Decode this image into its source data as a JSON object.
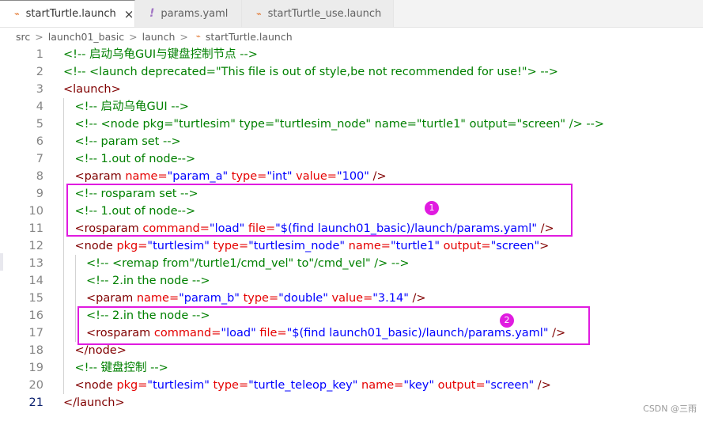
{
  "tabs": [
    {
      "label": "startTurtle.launch",
      "icon": "rss-icon",
      "close": "×",
      "active": true
    },
    {
      "label": "params.yaml",
      "icon": "exclamation-icon",
      "active": false
    },
    {
      "label": "startTurtle_use.launch",
      "icon": "rss-icon",
      "active": false
    }
  ],
  "breadcrumb": [
    "src",
    "launch01_basic",
    "launch",
    "startTurtle.launch"
  ],
  "breadcrumb_sep": ">",
  "line_numbers": [
    "1",
    "2",
    "3",
    "4",
    "5",
    "6",
    "7",
    "8",
    "9",
    "10",
    "11",
    "12",
    "13",
    "14",
    "15",
    "16",
    "17",
    "18",
    "19",
    "20",
    "21"
  ],
  "lines": [
    [
      {
        "t": "<!-- 启动乌龟GUI与键盘控制节点 -->",
        "k": "c"
      }
    ],
    [
      {
        "t": "<!-- <launch deprecated=\"This file is out of style,be not recommended for use!\"> -->",
        "k": "c"
      }
    ],
    [
      {
        "t": "<launch>",
        "k": "t"
      }
    ],
    [
      {
        "t": "<!-- 启动乌龟GUI -->",
        "k": "c"
      }
    ],
    [
      {
        "t": "<!-- <node pkg=\"turtlesim\" type=\"turtlesim_node\" name=\"turtle1\" output=\"screen\" /> -->",
        "k": "c"
      }
    ],
    [
      {
        "t": "<!-- param set -->",
        "k": "c"
      }
    ],
    [
      {
        "t": "<!-- 1.out of node-->",
        "k": "c"
      }
    ],
    [
      {
        "t": "<param",
        "k": "t"
      },
      {
        "t": " name=",
        "k": "a"
      },
      {
        "t": "\"param_a\"",
        "k": "s"
      },
      {
        "t": " type=",
        "k": "a"
      },
      {
        "t": "\"int\"",
        "k": "s"
      },
      {
        "t": " value=",
        "k": "a"
      },
      {
        "t": "\"100\"",
        "k": "s"
      },
      {
        "t": " />",
        "k": "t"
      }
    ],
    [
      {
        "t": "<!-- rosparam set -->",
        "k": "c"
      }
    ],
    [
      {
        "t": "<!-- 1.out of node-->",
        "k": "c"
      }
    ],
    [
      {
        "t": "<rosparam",
        "k": "t"
      },
      {
        "t": " command=",
        "k": "a"
      },
      {
        "t": "\"load\"",
        "k": "s"
      },
      {
        "t": " file=",
        "k": "a"
      },
      {
        "t": "\"$(find launch01_basic)/launch/params.yaml\"",
        "k": "s"
      },
      {
        "t": " />",
        "k": "t"
      }
    ],
    [
      {
        "t": "<node",
        "k": "t"
      },
      {
        "t": " pkg=",
        "k": "a"
      },
      {
        "t": "\"turtlesim\"",
        "k": "s"
      },
      {
        "t": " type=",
        "k": "a"
      },
      {
        "t": "\"turtlesim_node\"",
        "k": "s"
      },
      {
        "t": " name=",
        "k": "a"
      },
      {
        "t": "\"turtle1\"",
        "k": "s"
      },
      {
        "t": " output=",
        "k": "a"
      },
      {
        "t": "\"screen\"",
        "k": "s"
      },
      {
        "t": ">",
        "k": "t"
      }
    ],
    [
      {
        "t": "<!-- <remap from\"/turtle1/cmd_vel\" to\"/cmd_vel\" /> -->",
        "k": "c"
      }
    ],
    [
      {
        "t": "<!-- 2.in the node -->",
        "k": "c"
      }
    ],
    [
      {
        "t": "<param",
        "k": "t"
      },
      {
        "t": " name=",
        "k": "a"
      },
      {
        "t": "\"param_b\"",
        "k": "s"
      },
      {
        "t": " type=",
        "k": "a"
      },
      {
        "t": "\"double\"",
        "k": "s"
      },
      {
        "t": " value=",
        "k": "a"
      },
      {
        "t": "\"3.14\"",
        "k": "s"
      },
      {
        "t": " />",
        "k": "t"
      }
    ],
    [
      {
        "t": "<!-- 2.in the node -->",
        "k": "c"
      }
    ],
    [
      {
        "t": "<rosparam",
        "k": "t"
      },
      {
        "t": " command=",
        "k": "a"
      },
      {
        "t": "\"load\"",
        "k": "s"
      },
      {
        "t": " file=",
        "k": "a"
      },
      {
        "t": "\"$(find launch01_basic)/launch/params.yaml\"",
        "k": "s"
      },
      {
        "t": " />",
        "k": "t"
      }
    ],
    [
      {
        "t": "</node>",
        "k": "t"
      }
    ],
    [
      {
        "t": "<!-- 键盘控制 -->",
        "k": "c"
      }
    ],
    [
      {
        "t": "<node",
        "k": "t"
      },
      {
        "t": " pkg=",
        "k": "a"
      },
      {
        "t": "\"turtlesim\"",
        "k": "s"
      },
      {
        "t": " type=",
        "k": "a"
      },
      {
        "t": "\"turtle_teleop_key\"",
        "k": "s"
      },
      {
        "t": " name=",
        "k": "a"
      },
      {
        "t": "\"key\"",
        "k": "s"
      },
      {
        "t": " output=",
        "k": "a"
      },
      {
        "t": "\"screen\"",
        "k": "s"
      },
      {
        "t": " />",
        "k": "t"
      }
    ],
    [
      {
        "t": "</launch>",
        "k": "t"
      }
    ]
  ],
  "indent_levels": [
    0,
    0,
    0,
    1,
    1,
    1,
    1,
    1,
    1,
    1,
    1,
    1,
    2,
    2,
    2,
    2,
    2,
    1,
    1,
    1,
    0
  ],
  "current_line": 21,
  "annotations": [
    {
      "label": "1"
    },
    {
      "label": "2"
    }
  ],
  "annotation_color": "#e01be0",
  "watermark": "CSDN @三雨"
}
